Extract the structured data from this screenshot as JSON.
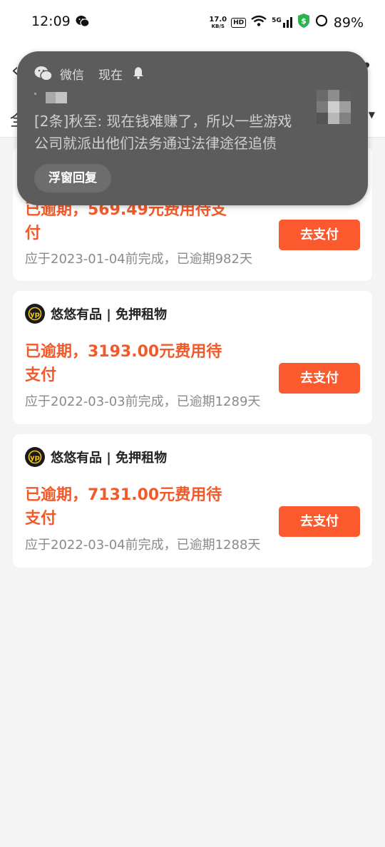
{
  "status_bar": {
    "time": "12:09",
    "net_speed_value": "17.0",
    "net_speed_unit": "KB/S",
    "hd_label": "HD",
    "signal_label": "5G",
    "battery_percent": "89%",
    "icons": [
      "wechat-icon",
      "wifi-icon",
      "signal-icon",
      "shield-dollar-icon",
      "battery-ring-icon"
    ]
  },
  "app_header": {
    "back_glyph": "‹",
    "more_glyph": "•",
    "tab_label_partial": "全",
    "caret_glyph": "▼"
  },
  "notification": {
    "app_name": "微信",
    "time": "现在",
    "message": "[2条]秋至: 现在钱难赚了，所以一些游戏公司就派出他们法务通过法律途径追债",
    "reply_button": "浮窗回复",
    "bg_color": "#5c5c5c"
  },
  "orders": [
    {
      "merchant": "",
      "overdue_text": "已逾期，569.49元费用待支付",
      "due_note": "应于2023-01-04前完成，已逾期982天",
      "pay_button": "去支付"
    },
    {
      "merchant": "悠悠有品 | 免押租物",
      "overdue_text": "已逾期，3193.00元费用待支付",
      "due_note": "应于2022-03-03前完成，已逾期1289天",
      "pay_button": "去支付"
    },
    {
      "merchant": "悠悠有品 | 免押租物",
      "overdue_text": "已逾期，7131.00元费用待支付",
      "due_note": "应于2022-03-04前完成，已逾期1288天",
      "pay_button": "去支付"
    }
  ],
  "colors": {
    "accent": "#fb5a2e",
    "overdue_text": "#f25a2a",
    "background": "#f4f4f4",
    "logo_gold": "#f5c518"
  }
}
